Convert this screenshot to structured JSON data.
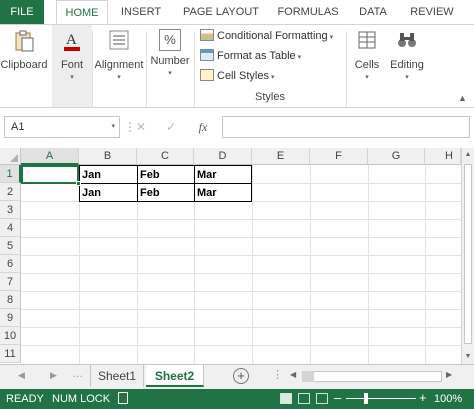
{
  "ribbon": {
    "tabs": [
      "FILE",
      "HOME",
      "INSERT",
      "PAGE LAYOUT",
      "FORMULAS",
      "DATA",
      "REVIEW"
    ],
    "active_tab": "HOME",
    "groups": {
      "clipboard": "Clipboard",
      "font": "Font",
      "alignment": "Alignment",
      "number": "Number",
      "cells": "Cells",
      "editing": "Editing"
    },
    "styles": {
      "conditional_formatting": "Conditional Formatting",
      "format_as_table": "Format as Table",
      "cell_styles": "Cell Styles",
      "group_label": "Styles"
    },
    "number_glyph": "%"
  },
  "formula_bar": {
    "name_box": "A1",
    "fx_label": "fx",
    "formula": ""
  },
  "grid": {
    "columns": [
      "A",
      "B",
      "C",
      "D",
      "E",
      "F",
      "G",
      "H"
    ],
    "rows": [
      "1",
      "2",
      "3",
      "4",
      "5",
      "6",
      "7",
      "8",
      "9",
      "10",
      "11"
    ],
    "selected_cell": "A1",
    "cells": {
      "B1": "Jan",
      "C1": "Feb",
      "D1": "Mar",
      "B2": "Jan",
      "C2": "Feb",
      "D2": "Mar"
    }
  },
  "sheets": {
    "tabs": [
      "Sheet1",
      "Sheet2"
    ],
    "active": "Sheet2",
    "add_symbol": "+"
  },
  "status_bar": {
    "ready": "READY",
    "num_lock": "NUM LOCK",
    "zoom": "100%"
  },
  "colors": {
    "accent": "#217346",
    "status_bar": "#217346"
  },
  "icons": {
    "clipboard": "paste-icon",
    "font": "font-color-icon",
    "alignment": "align-icon",
    "number": "percent-icon",
    "cells": "cells-icon",
    "editing": "binoculars-icon"
  }
}
